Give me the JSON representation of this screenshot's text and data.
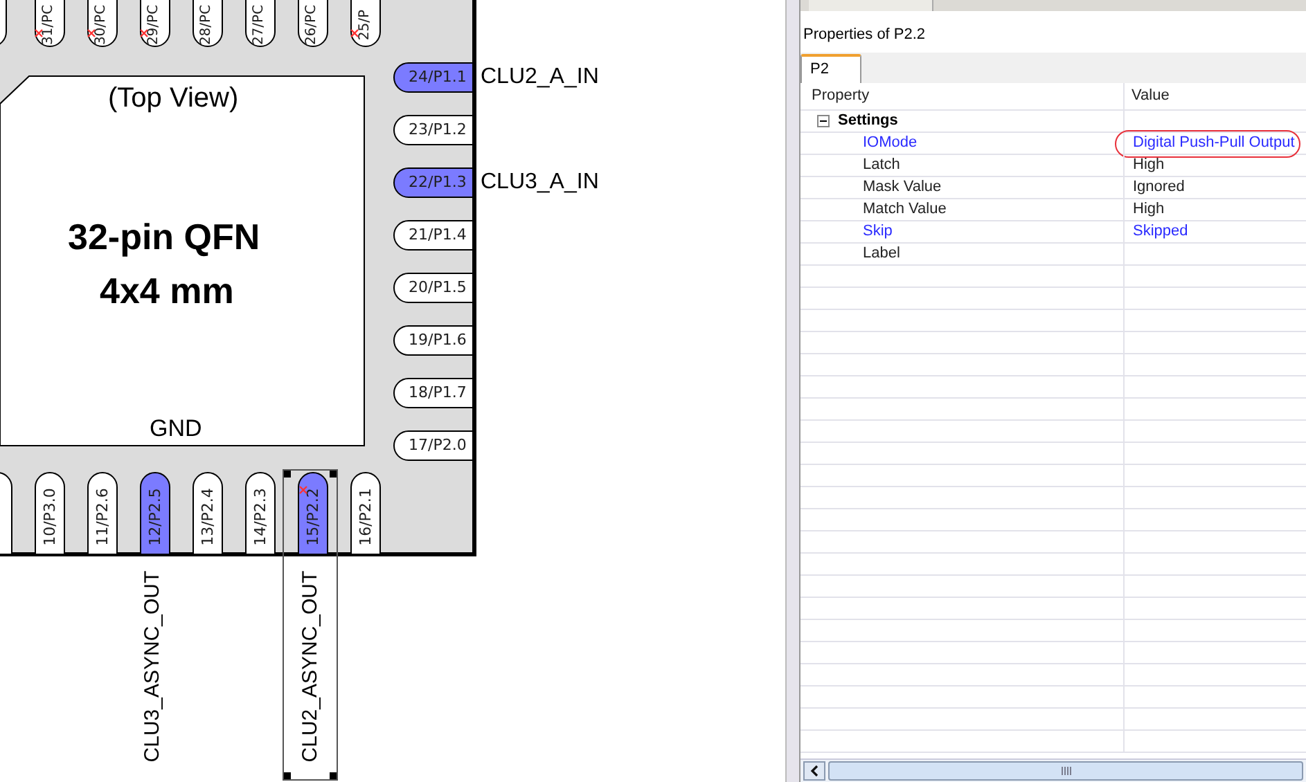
{
  "chip": {
    "view_label": "(Top View)",
    "package": "32-pin QFN",
    "size": "4x4 mm",
    "ground_label": "GND",
    "top_pins": [
      {
        "label": "31/PC",
        "highlighted": false,
        "error": true
      },
      {
        "label": "30/PC",
        "highlighted": false,
        "error": true
      },
      {
        "label": "29/PC",
        "highlighted": false,
        "error": true
      },
      {
        "label": "28/PC",
        "highlighted": false,
        "error": false
      },
      {
        "label": "27/PC",
        "highlighted": false,
        "error": false
      },
      {
        "label": "26/PC",
        "highlighted": false,
        "error": false
      },
      {
        "label": "25/P",
        "highlighted": false,
        "error": true
      }
    ],
    "right_pins": [
      {
        "label": "24/P1.1",
        "highlighted": true,
        "net": "CLU2_A_IN"
      },
      {
        "label": "23/P1.2",
        "highlighted": false
      },
      {
        "label": "22/P1.3",
        "highlighted": true,
        "net": "CLU3_A_IN"
      },
      {
        "label": "21/P1.4",
        "highlighted": false
      },
      {
        "label": "20/P1.5",
        "highlighted": false
      },
      {
        "label": "19/P1.6",
        "highlighted": false
      },
      {
        "label": "18/P1.7",
        "highlighted": false
      },
      {
        "label": "17/P2.0",
        "highlighted": false
      }
    ],
    "bottom_pins": [
      {
        "label": "10/P3.0",
        "highlighted": false,
        "error": false
      },
      {
        "label": "11/P2.6",
        "highlighted": false,
        "error": false
      },
      {
        "label": "12/P2.5",
        "highlighted": true,
        "error": false,
        "net": "CLU3_ASYNC_OUT",
        "net_selected": false
      },
      {
        "label": "13/P2.4",
        "highlighted": false,
        "error": false
      },
      {
        "label": "14/P2.3",
        "highlighted": false,
        "error": false
      },
      {
        "label": "15/P2.2",
        "highlighted": true,
        "error": true,
        "net": "CLU2_ASYNC_OUT",
        "net_selected": true
      },
      {
        "label": "16/P2.1",
        "highlighted": false,
        "error": false
      }
    ]
  },
  "properties": {
    "title": "Properties of P2.2",
    "tabs": [
      {
        "label": "P2",
        "selected": true
      }
    ],
    "columns": [
      "Property",
      "Value"
    ],
    "groups": [
      {
        "name": "Settings",
        "expanded": true,
        "rows": [
          {
            "property": "IOMode",
            "value": "Digital Push-Pull Output",
            "modified": true,
            "circled": true
          },
          {
            "property": "Latch",
            "value": "High",
            "modified": false
          },
          {
            "property": "Mask Value",
            "value": "Ignored",
            "modified": false
          },
          {
            "property": "Match Value",
            "value": "High",
            "modified": false
          },
          {
            "property": "Skip",
            "value": "Skipped",
            "modified": true
          },
          {
            "property": "Label",
            "modified": false
          }
        ]
      }
    ]
  }
}
